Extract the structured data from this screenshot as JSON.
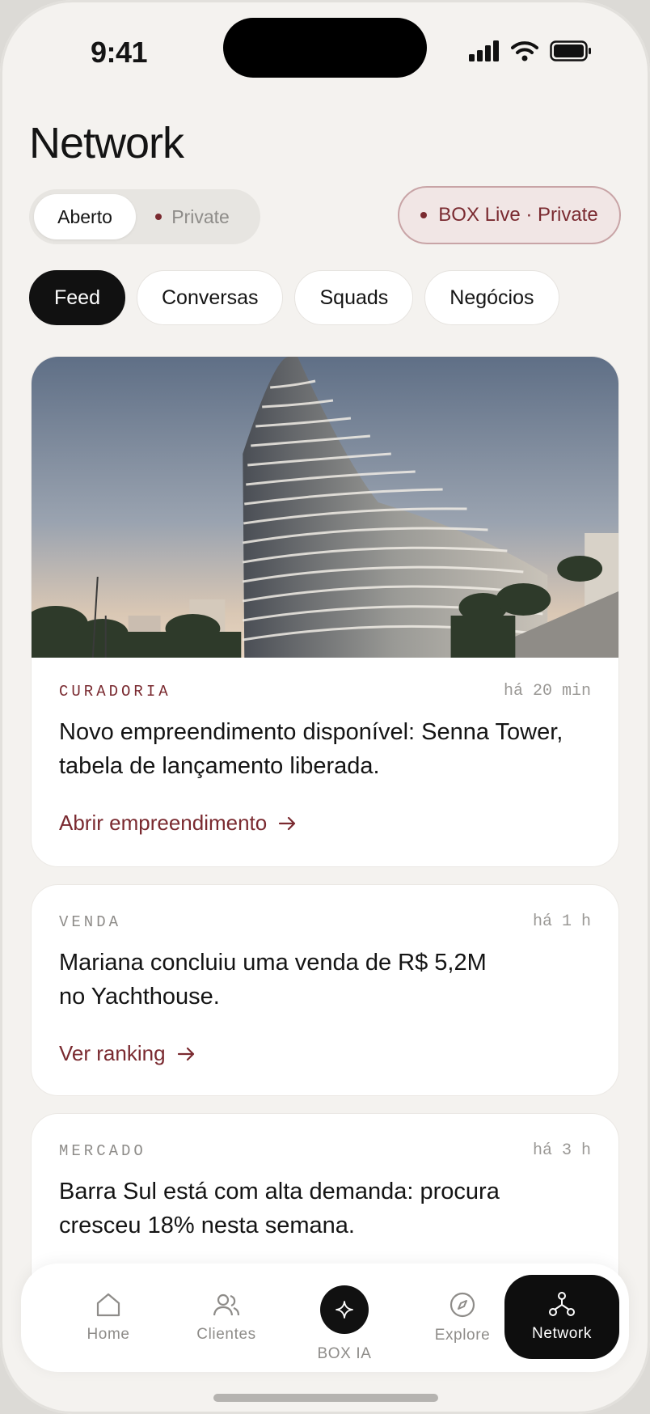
{
  "status_bar": {
    "time": "9:41"
  },
  "page": {
    "title": "Network"
  },
  "mode_toggle": {
    "open_label": "Aberto",
    "private_label": "Private"
  },
  "live_pill": {
    "label": "BOX Live · Private"
  },
  "tabs": [
    "Feed",
    "Conversas",
    "Squads",
    "Negócios"
  ],
  "feed": [
    {
      "category": "CURADORIA",
      "time_ago": "há 20 min",
      "headline": "Novo empreendimento disponível: Senna Tower, tabela de lançamento liberada.",
      "action": "Abrir empreendimento"
    },
    {
      "category": "VENDA",
      "time_ago": "há 1 h",
      "headline": "Mariana concluiu uma venda de R$ 5,2M no Yachthouse.",
      "action": "Ver ranking"
    },
    {
      "category": "MERCADO",
      "time_ago": "há 3 h",
      "headline": "Barra Sul está com alta demanda: procura cresceu 18% nesta semana."
    }
  ],
  "bottom_nav": {
    "home": "Home",
    "clients": "Clientes",
    "ai": "BOX IA",
    "explore": "Explore",
    "network": "Network"
  },
  "colors": {
    "accent": "#7a2a30",
    "background": "#f4f2ef",
    "active": "#111111"
  }
}
